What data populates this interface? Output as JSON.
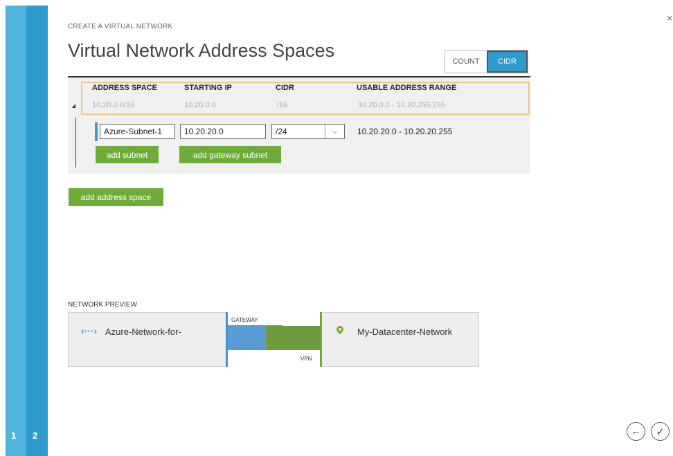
{
  "wizard": {
    "steps": [
      "1",
      "2"
    ],
    "subtitle": "CREATE A VIRTUAL NETWORK",
    "title": "Virtual Network Address Spaces",
    "close_glyph": "×",
    "back_glyph": "←",
    "finish_glyph": "✓"
  },
  "toggle": {
    "count_label": "COUNT",
    "cidr_label": "CIDR",
    "selected": "CIDR",
    "accent_color": "#2f9bcc"
  },
  "address_space": {
    "columns": [
      "ADDRESS SPACE",
      "STARTING IP",
      "CIDR",
      "USABLE ADDRESS RANGE"
    ],
    "row": {
      "address_space": "10.20.0.0/16",
      "starting_ip": "10.20.0.0",
      "cidr": "/16",
      "usable_range": "10.20.0.0 - 10.20.255.255"
    },
    "subnet": {
      "name": "Azure-Subnet-1",
      "starting_ip": "10.20.20.0",
      "cidr": "/24",
      "usable_range": "10.20.20.0 - 10.20.20.255"
    },
    "add_subnet_label": "add subnet",
    "add_gateway_subnet_label": "add gateway subnet"
  },
  "add_address_space_label": "add address space",
  "preview": {
    "label": "NETWORK PREVIEW",
    "left_network": "Azure-Network-for-",
    "left_icon_glyph": "‹···›",
    "gateway_label": "GATEWAY",
    "vpn_label": "VPN",
    "right_network": "My-Datacenter-Network",
    "button_color": "#6eab3a"
  }
}
